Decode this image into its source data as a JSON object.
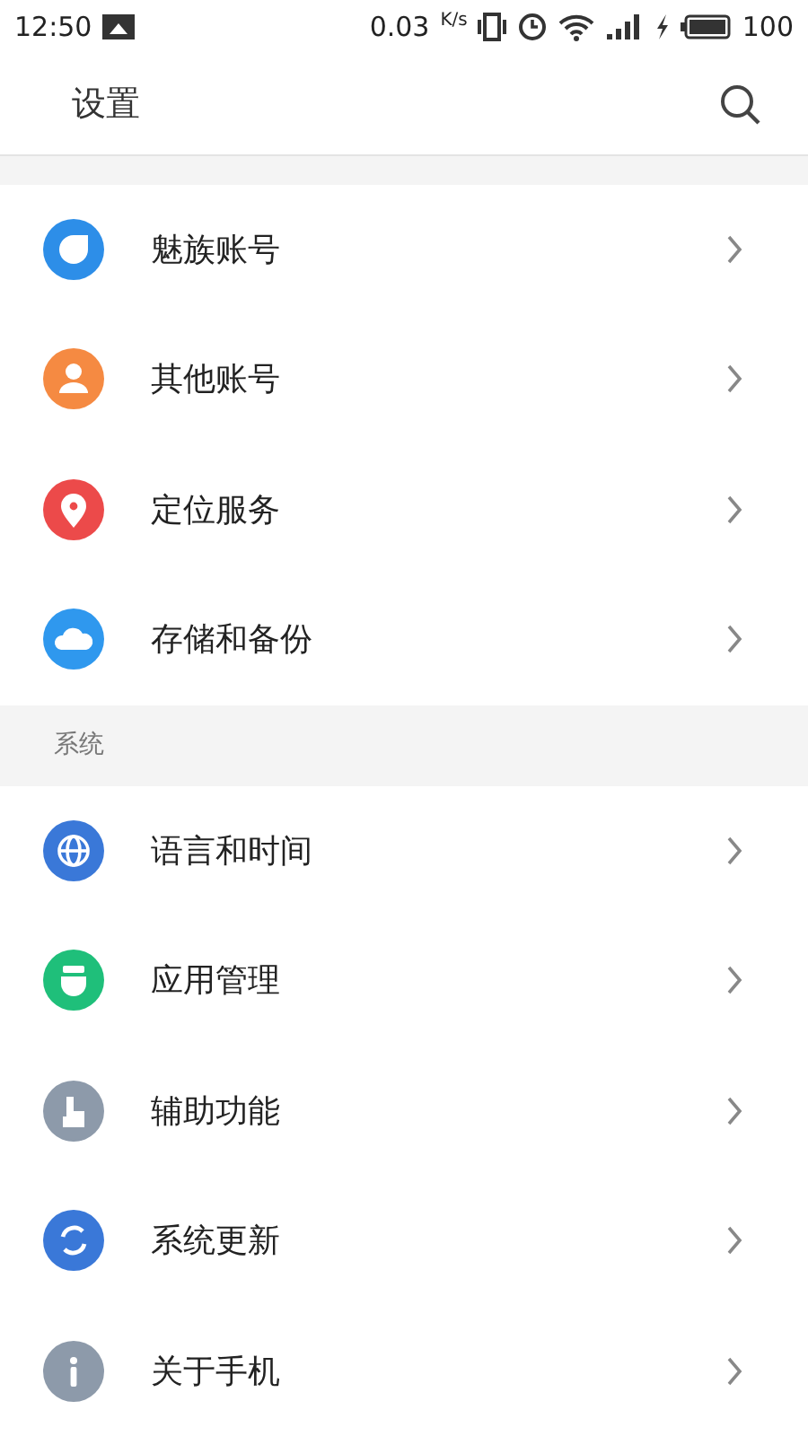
{
  "status_bar": {
    "time": "12:50",
    "speed": "0.03",
    "speed_unit": "K/s",
    "battery": "100"
  },
  "app_bar": {
    "title": "设置"
  },
  "sections": [
    {
      "items": [
        {
          "label": "魅族账号",
          "color": "#2d8ee8"
        },
        {
          "label": "其他账号",
          "color": "#f58a42"
        },
        {
          "label": "定位服务",
          "color": "#ec4a4a"
        },
        {
          "label": "存储和备份",
          "color": "#2f98ee"
        }
      ]
    },
    {
      "title": "系统",
      "items": [
        {
          "label": "语言和时间",
          "color": "#3a78d8"
        },
        {
          "label": "应用管理",
          "color": "#1fbf7a"
        },
        {
          "label": "辅助功能",
          "color": "#8d9aaa"
        },
        {
          "label": "系统更新",
          "color": "#3a78d8"
        },
        {
          "label": "关于手机",
          "color": "#8d9aaa"
        }
      ]
    }
  ]
}
